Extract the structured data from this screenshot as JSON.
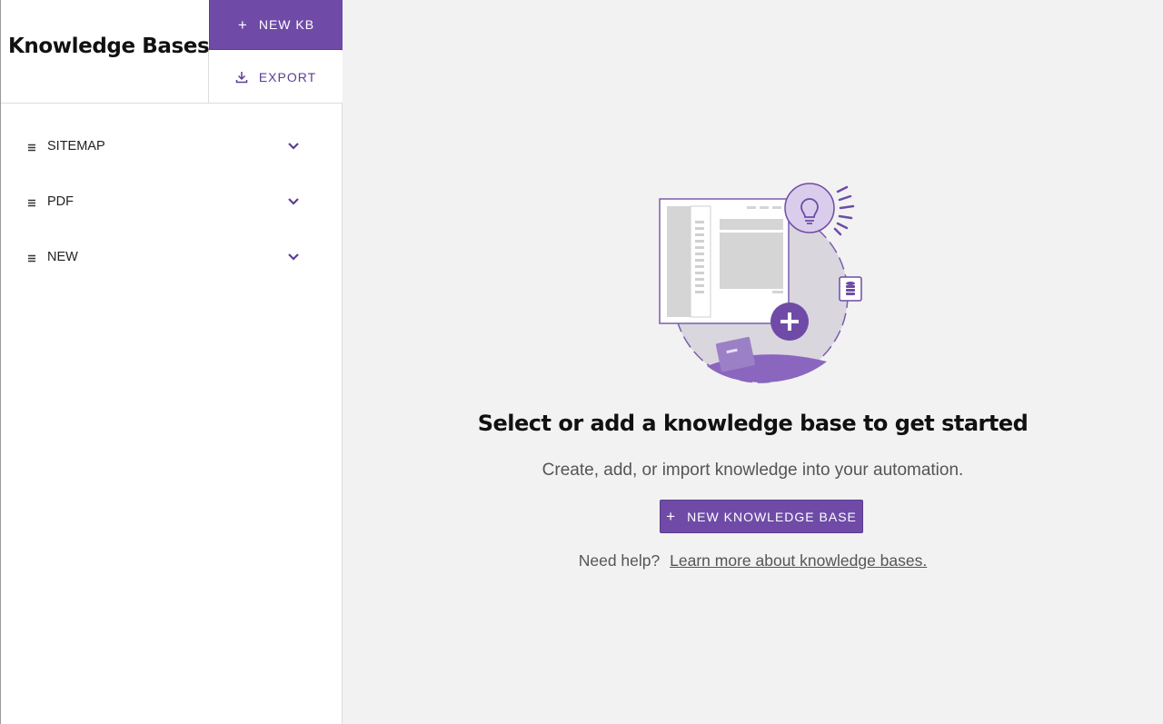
{
  "sidebar": {
    "title": "Knowledge Bases",
    "new_kb_label": "NEW KB",
    "export_label": "EXPORT",
    "items": [
      {
        "label": "SITEMAP"
      },
      {
        "label": "PDF"
      },
      {
        "label": "NEW"
      }
    ]
  },
  "main": {
    "headline": "Select or add a knowledge base to get started",
    "subtext": "Create, add, or import knowledge into your automation.",
    "button_label": "NEW KNOWLEDGE BASE",
    "help_prefix": "Need help?",
    "help_link": "Learn more about knowledge bases."
  },
  "colors": {
    "accent": "#6f4ba7",
    "accent_dark": "#5d3d94",
    "background": "#f2f2f2"
  },
  "icons": {
    "plus": "plus-icon",
    "download": "download-icon",
    "grip": "drag-grip-icon",
    "chevron": "chevron-down-icon"
  }
}
